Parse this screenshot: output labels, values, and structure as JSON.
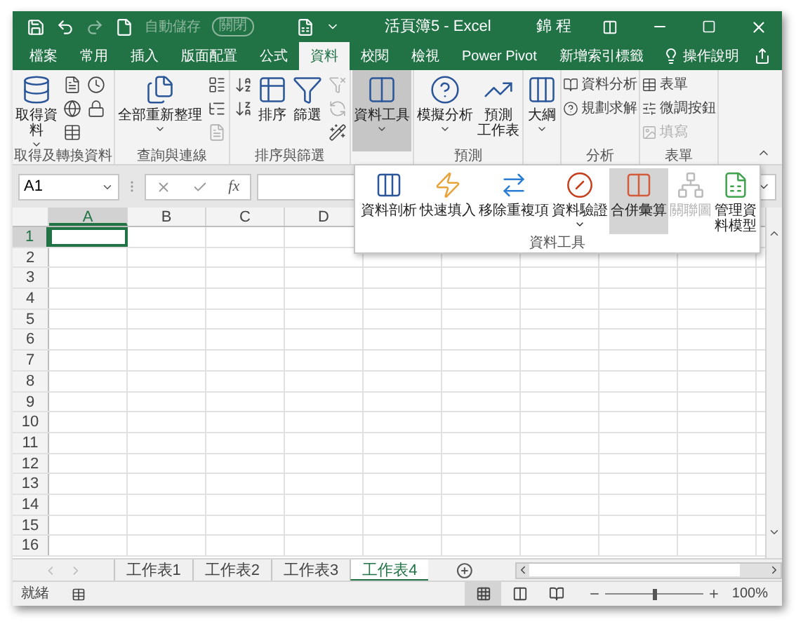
{
  "title_bar": {
    "autosave_label": "自動儲存",
    "autosave_toggle": "關閉",
    "autosave_disabled": true,
    "title": "活頁簿5 - Excel",
    "user": "錦 程"
  },
  "tabs": [
    {
      "label": "檔案",
      "selected": false
    },
    {
      "label": "常用",
      "selected": false
    },
    {
      "label": "插入",
      "selected": false
    },
    {
      "label": "版面配置",
      "selected": false
    },
    {
      "label": "公式",
      "selected": false
    },
    {
      "label": "資料",
      "selected": true
    },
    {
      "label": "校閱",
      "selected": false
    },
    {
      "label": "檢視",
      "selected": false
    },
    {
      "label": "Power Pivot",
      "selected": false
    },
    {
      "label": "新增索引標籤",
      "selected": false
    }
  ],
  "tell_me": "操作說明",
  "ribbon": [
    {
      "label": "取得及轉換資料",
      "items": [
        {
          "kind": "large",
          "lines": [
            "取得資",
            "料"
          ],
          "caret": true,
          "pressed": false
        },
        {
          "kind": "stack",
          "items": [
            {
              "kind": "icon",
              "disabled": false
            },
            {
              "kind": "icon",
              "disabled": false
            },
            {
              "kind": "icon",
              "disabled": false
            }
          ]
        },
        {
          "kind": "stack",
          "items": [
            {
              "kind": "icon",
              "disabled": false
            },
            {
              "kind": "icon",
              "disabled": false
            }
          ]
        }
      ]
    },
    {
      "label": "查詢與連線",
      "items": [
        {
          "kind": "large",
          "lines": [
            "全部重新整理"
          ],
          "caret": true,
          "pressed": false
        },
        {
          "kind": "stack",
          "items": [
            {
              "kind": "icon",
              "disabled": false
            },
            {
              "kind": "icon",
              "disabled": false
            },
            {
              "kind": "icon",
              "disabled": true
            }
          ]
        }
      ]
    },
    {
      "label": "排序與篩選",
      "items": [
        {
          "kind": "stack",
          "items": [
            {
              "kind": "icon",
              "disabled": false
            },
            {
              "kind": "icon",
              "disabled": false
            }
          ]
        },
        {
          "kind": "large",
          "lines": [
            "排序"
          ],
          "caret": false,
          "pressed": false
        },
        {
          "kind": "large",
          "lines": [
            "篩選"
          ],
          "caret": false,
          "pressed": false
        },
        {
          "kind": "stack",
          "items": [
            {
              "kind": "icon",
              "disabled": true
            },
            {
              "kind": "icon",
              "disabled": true
            },
            {
              "kind": "icon",
              "disabled": false
            }
          ]
        }
      ]
    },
    {
      "items": [
        {
          "kind": "large",
          "lines": [
            "資料工具"
          ],
          "caret": true,
          "pressed": true
        }
      ]
    },
    {
      "label": "預測",
      "items": [
        {
          "kind": "large",
          "lines": [
            "模擬分析"
          ],
          "caret": true,
          "pressed": false
        },
        {
          "kind": "large",
          "lines": [
            "預測",
            "工作表"
          ],
          "caret": false,
          "pressed": false
        }
      ]
    },
    {
      "items": [
        {
          "kind": "large",
          "lines": [
            "大綱"
          ],
          "caret": true,
          "pressed": false
        }
      ]
    },
    {
      "label": "分析",
      "items": [
        {
          "kind": "stack",
          "items": [
            {
              "kind": "small",
              "label": "資料分析",
              "disabled": false
            },
            {
              "kind": "small",
              "label": "規劃求解",
              "disabled": false
            }
          ]
        }
      ]
    },
    {
      "label": "表單",
      "items": [
        {
          "kind": "stack",
          "items": [
            {
              "kind": "small",
              "label": "表單",
              "disabled": false
            },
            {
              "kind": "small",
              "label": "微調按鈕",
              "disabled": false
            },
            {
              "kind": "small",
              "label": "填寫",
              "disabled": true
            }
          ]
        }
      ]
    }
  ],
  "dropdown": {
    "label": "資料工具",
    "items": [
      {
        "lines": [
          "資料剖析"
        ],
        "caret": false,
        "highlighted": false,
        "disabled": false
      },
      {
        "lines": [
          "快速填入"
        ],
        "caret": false,
        "highlighted": false,
        "disabled": false
      },
      {
        "lines": [
          "移除重複項"
        ],
        "caret": false,
        "highlighted": false,
        "disabled": false
      },
      {
        "lines": [
          "資料驗證"
        ],
        "caret": true,
        "highlighted": false,
        "disabled": false
      },
      {
        "lines": [
          "合併彙算"
        ],
        "caret": false,
        "highlighted": true,
        "disabled": false
      },
      {
        "lines": [
          "關聯圖"
        ],
        "caret": false,
        "highlighted": false,
        "disabled": true
      },
      {
        "lines": [
          "管理資",
          "料模型"
        ],
        "caret": false,
        "highlighted": false,
        "disabled": false
      }
    ]
  },
  "formula_bar": {
    "name_box": "A1",
    "fx": "fx"
  },
  "columns": [
    {
      "label": "A",
      "selected": true
    },
    {
      "label": "B",
      "selected": false
    },
    {
      "label": "C",
      "selected": false
    },
    {
      "label": "D",
      "selected": false
    }
  ],
  "rows": [
    {
      "label": "1",
      "selected": true
    },
    {
      "label": "2",
      "selected": false
    },
    {
      "label": "3",
      "selected": false
    },
    {
      "label": "4",
      "selected": false
    },
    {
      "label": "5",
      "selected": false
    },
    {
      "label": "6",
      "selected": false
    },
    {
      "label": "7",
      "selected": false
    },
    {
      "label": "8",
      "selected": false
    },
    {
      "label": "9",
      "selected": false
    },
    {
      "label": "10",
      "selected": false
    },
    {
      "label": "11",
      "selected": false
    },
    {
      "label": "12",
      "selected": false
    },
    {
      "label": "13",
      "selected": false
    },
    {
      "label": "14",
      "selected": false
    },
    {
      "label": "15",
      "selected": false
    },
    {
      "label": "16",
      "selected": false
    }
  ],
  "sheets": [
    {
      "label": "工作表1",
      "selected": false
    },
    {
      "label": "工作表2",
      "selected": false
    },
    {
      "label": "工作表3",
      "selected": false
    },
    {
      "label": "工作表4",
      "selected": true
    }
  ],
  "status_bar": {
    "status": "就緒",
    "views": [
      {
        "kind": "normal",
        "selected": true
      },
      {
        "kind": "page_layout",
        "selected": false
      },
      {
        "kind": "page_break",
        "selected": false
      }
    ],
    "zoom_slider": {
      "level": 0.5
    },
    "zoom": "100%"
  }
}
